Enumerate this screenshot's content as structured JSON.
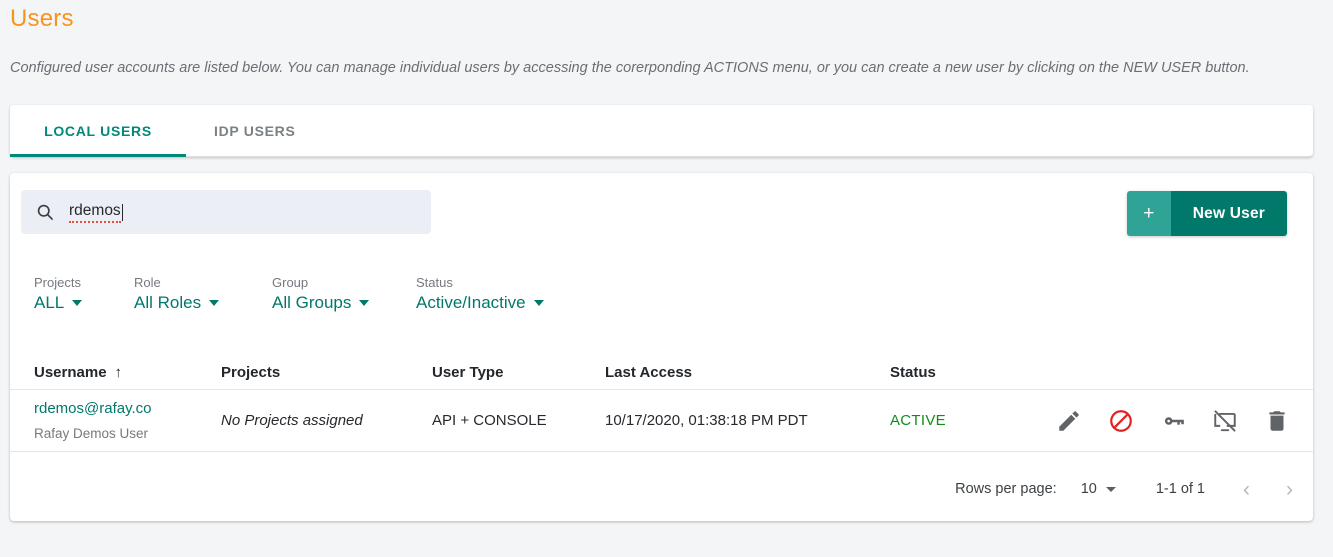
{
  "header": {
    "title": "Users",
    "description": "Configured user accounts are listed below. You can manage individual users by accessing the corerponding ACTIONS menu, or you can create a new user by clicking on the NEW USER button."
  },
  "tabs": [
    {
      "label": "LOCAL USERS",
      "active": true
    },
    {
      "label": "IDP USERS",
      "active": false
    }
  ],
  "search": {
    "value": "rdemos",
    "icon": "search-icon"
  },
  "new_user_button": {
    "plus": "+",
    "label": "New User"
  },
  "filters": [
    {
      "label": "Projects",
      "value": "ALL"
    },
    {
      "label": "Role",
      "value": "All Roles"
    },
    {
      "label": "Group",
      "value": "All Groups"
    },
    {
      "label": "Status",
      "value": "Active/Inactive"
    }
  ],
  "table": {
    "columns": [
      "Username",
      "Projects",
      "User Type",
      "Last Access",
      "Status"
    ],
    "sort": {
      "column": "Username",
      "direction": "↑"
    },
    "rows": [
      {
        "username": "rdemos@rafay.co",
        "fullname": "Rafay Demos User",
        "projects": "No Projects assigned",
        "user_type": "API + CONSOLE",
        "last_access": "10/17/2020, 01:38:18 PM PDT",
        "status": "ACTIVE",
        "actions": [
          "edit-icon",
          "block-icon",
          "key-icon",
          "screen-off-icon",
          "delete-icon"
        ]
      }
    ]
  },
  "pagination": {
    "rows_per_page_label": "Rows per page:",
    "rows_per_page_value": "10",
    "range": "1-1 of 1",
    "prev": "‹",
    "next": "›"
  },
  "colors": {
    "accent_teal": "#00796b",
    "title_orange": "#f7941e",
    "status_active_green": "#128c18",
    "block_red": "#e32020"
  }
}
